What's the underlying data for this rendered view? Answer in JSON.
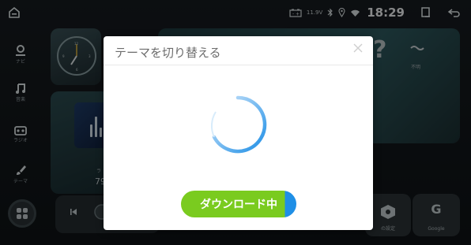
{
  "status_bar": {
    "battery_voltage": "11.9V",
    "time": "18:29"
  },
  "sidebar": {
    "items": [
      {
        "label": "ナビ",
        "icon": "navigation-pin-icon"
      },
      {
        "label": "音楽",
        "icon": "music-note-icon"
      },
      {
        "label": "ラジオ",
        "icon": "radio-icon"
      },
      {
        "label": "テーマ",
        "icon": "paintbrush-icon"
      }
    ],
    "apps_icon": "apps-grid-icon"
  },
  "background_widgets": {
    "clock_numbers": [
      "12",
      "3",
      "6",
      "9"
    ],
    "music_track_partial": "ラ",
    "music_freq_partial": "79",
    "weather_label": "不明",
    "weather_symbol": "?",
    "settings_tile_label": "の設定",
    "google_tile_label": "Google",
    "google_tile_letter": "G"
  },
  "dialog": {
    "title": "テーマを切り替える",
    "download_button_label": "ダウンロード中",
    "download_progress": 0.1,
    "accent_color": "#1f8fe6",
    "button_color": "#7acb1f"
  }
}
